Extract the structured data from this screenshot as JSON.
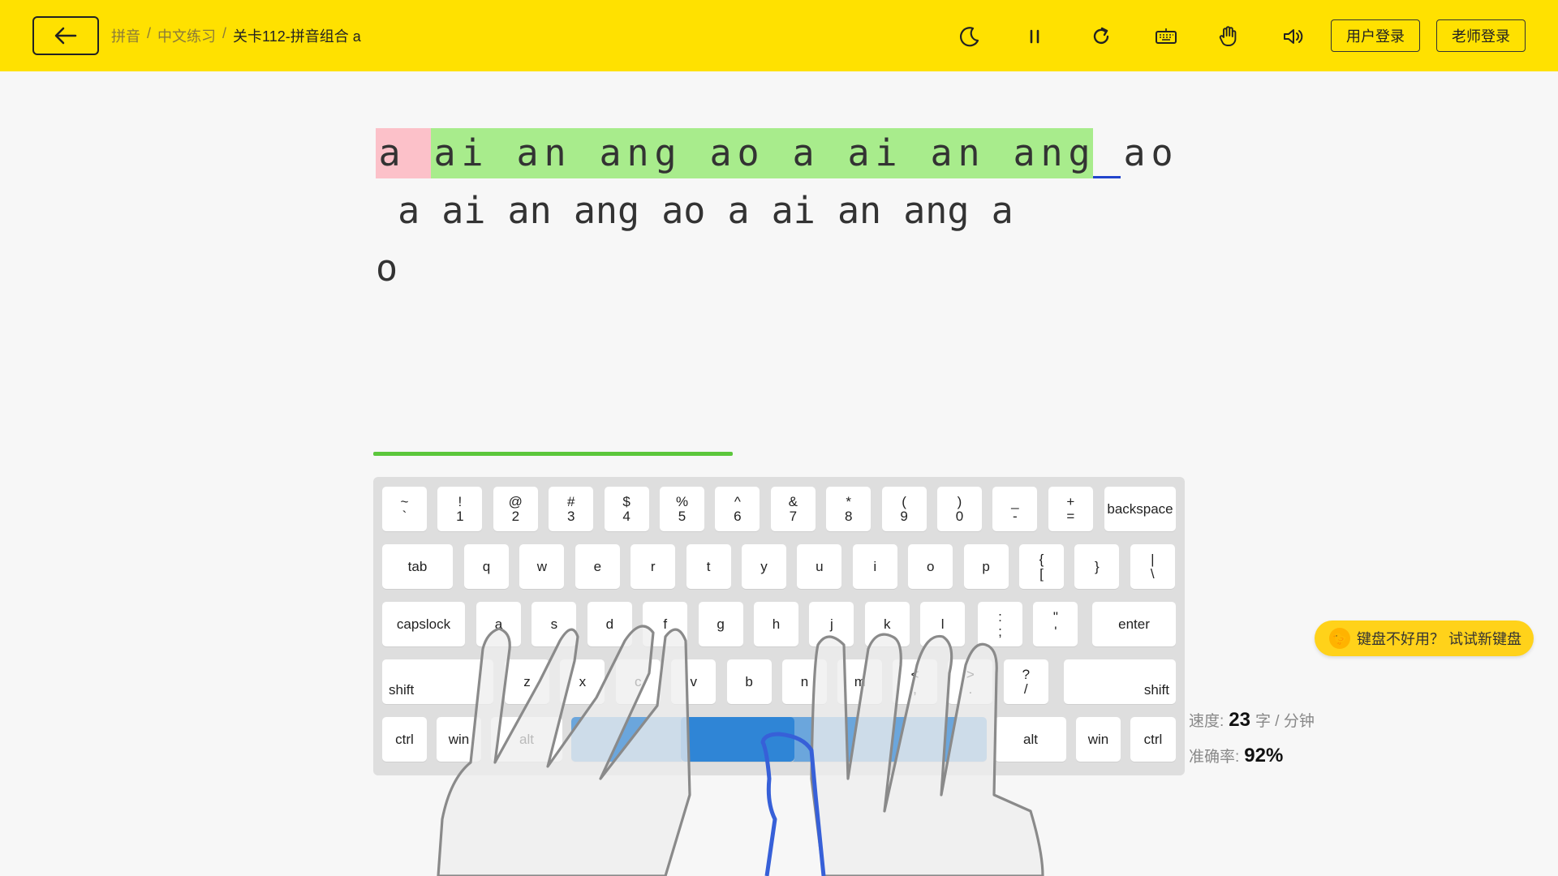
{
  "header": {
    "breadcrumb": [
      "拼音",
      "中文练习",
      "关卡112-拼音组合 a"
    ],
    "separator": "/",
    "login_user": "用户登录",
    "login_teacher": "老师登录",
    "tools": [
      "moon-icon",
      "pause-icon",
      "restart-icon",
      "keyboard-icon",
      "hand-icon",
      "sound-icon"
    ]
  },
  "practice": {
    "line1": [
      {
        "c": "a",
        "s": "err"
      },
      {
        "c": " ",
        "s": "err"
      },
      {
        "c": "a",
        "s": "ok"
      },
      {
        "c": "i",
        "s": "ok"
      },
      {
        "c": " ",
        "s": "ok"
      },
      {
        "c": "a",
        "s": "ok"
      },
      {
        "c": "n",
        "s": "ok"
      },
      {
        "c": " ",
        "s": "ok"
      },
      {
        "c": "a",
        "s": "ok"
      },
      {
        "c": "n",
        "s": "ok"
      },
      {
        "c": "g",
        "s": "ok"
      },
      {
        "c": " ",
        "s": "ok"
      },
      {
        "c": "a",
        "s": "ok"
      },
      {
        "c": "o",
        "s": "ok"
      },
      {
        "c": " ",
        "s": "ok"
      },
      {
        "c": "a",
        "s": "ok"
      },
      {
        "c": " ",
        "s": "ok"
      },
      {
        "c": "a",
        "s": "ok"
      },
      {
        "c": "i",
        "s": "ok"
      },
      {
        "c": " ",
        "s": "ok"
      },
      {
        "c": "a",
        "s": "ok"
      },
      {
        "c": "n",
        "s": "ok"
      },
      {
        "c": " ",
        "s": "ok"
      },
      {
        "c": "a",
        "s": "ok"
      },
      {
        "c": "n",
        "s": "ok"
      },
      {
        "c": "g",
        "s": "ok"
      },
      {
        "c": " ",
        "s": "cursor"
      },
      {
        "c": "a",
        "s": ""
      },
      {
        "c": "o",
        "s": ""
      }
    ],
    "line2": " a ai an ang ao a ai an ang a",
    "line3": "o",
    "progress_fraction": 0.54
  },
  "keyboard": {
    "row1": [
      [
        "~",
        "`"
      ],
      [
        "!",
        "1"
      ],
      [
        "@",
        "2"
      ],
      [
        "#",
        "3"
      ],
      [
        "$",
        "4"
      ],
      [
        "%",
        "5"
      ],
      [
        "^",
        "6"
      ],
      [
        "&",
        "7"
      ],
      [
        "*",
        "8"
      ],
      [
        "(",
        "9"
      ],
      [
        ")",
        "0"
      ],
      [
        "_",
        "-"
      ],
      [
        "+",
        "="
      ]
    ],
    "backspace": "backspace",
    "tab": "tab",
    "row2": [
      "q",
      "w",
      "e",
      "r",
      "t",
      "y",
      "u",
      "i",
      "o",
      "p"
    ],
    "row2_sym": [
      [
        "{",
        "["
      ],
      [
        "",
        "}"
      ],
      [
        "|",
        "\\"
      ]
    ],
    "capslock": "capslock",
    "row3": [
      "a",
      "s",
      "d",
      "f",
      "g",
      "h",
      "j",
      "k",
      "l"
    ],
    "row3_sym": [
      [
        ":",
        ";"
      ],
      [
        "\"",
        "'"
      ]
    ],
    "enter": "enter",
    "shift": "shift",
    "row4": [
      "z",
      "x",
      "c",
      "v",
      "b",
      "n",
      "m"
    ],
    "row4_sym": [
      [
        "<",
        ","
      ],
      [
        ">",
        "."
      ],
      [
        "?",
        "/"
      ]
    ],
    "ctrl": "ctrl",
    "win": "win",
    "alt": "alt"
  },
  "promo": "键盘不好用？ 试试新键盘",
  "stats": {
    "speed_label": "速度:",
    "speed_value": "23",
    "speed_unit": "字 / 分钟",
    "accuracy_label": "准确率:",
    "accuracy_value": "92%"
  }
}
